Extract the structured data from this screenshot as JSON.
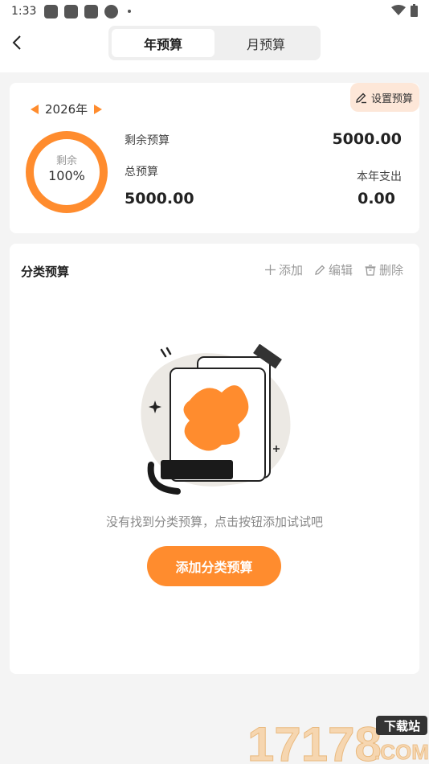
{
  "status_bar": {
    "time": "1:33"
  },
  "tabs": [
    {
      "label": "年预算",
      "active": true
    },
    {
      "label": "月预算",
      "active": false
    }
  ],
  "summary": {
    "set_budget_label": "设置预算",
    "year_label": "2026年",
    "donut_label": "剩余",
    "donut_percent": "100%",
    "remaining_label": "剩余预算",
    "remaining_value": "5000.00",
    "total_label": "总预算",
    "total_value": "5000.00",
    "spent_label": "本年支出",
    "spent_value": "0.00"
  },
  "category": {
    "title": "分类预算",
    "add_label": "添加",
    "edit_label": "编辑",
    "delete_label": "删除",
    "empty_text": "没有找到分类预算，点击按钮添加试试吧",
    "add_button_label": "添加分类预算"
  },
  "watermark": {
    "number": "17178",
    "badge": "下载站",
    "domain": ".COM"
  },
  "colors": {
    "accent": "#ff8c2e",
    "accent_light": "#fde7d8"
  }
}
